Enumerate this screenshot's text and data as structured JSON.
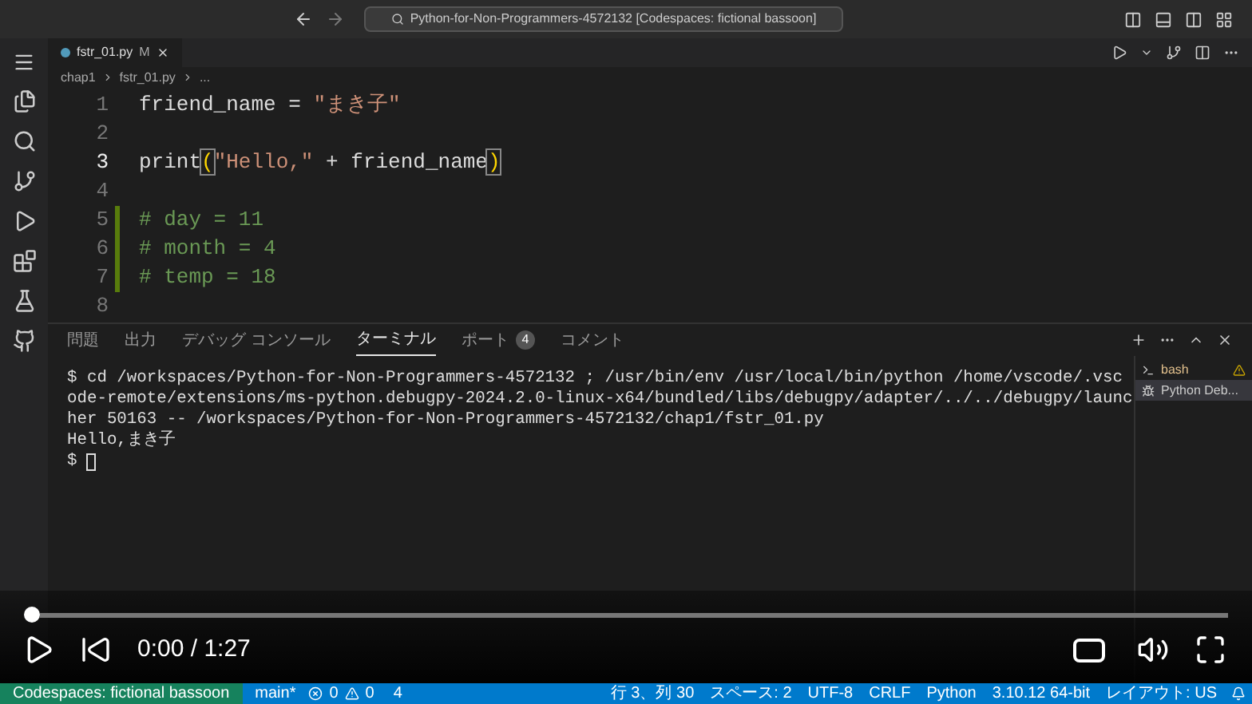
{
  "title_bar": {
    "search": "Python-for-Non-Programmers-4572132 [Codespaces: fictional bassoon]"
  },
  "editor_tabs": [
    {
      "label": "fstr_01.py",
      "badge": "M",
      "selected": true
    }
  ],
  "breadcrumb": [
    "chap1",
    "fstr_01.py",
    "..."
  ],
  "editor": {
    "lines": [
      {
        "number": "1",
        "current": false,
        "tokens": [
          {
            "kind": "plain",
            "text": "friend_name = "
          },
          {
            "kind": "string",
            "text": "\"まき子\""
          }
        ]
      },
      {
        "number": "2",
        "current": false
      },
      {
        "number": "3",
        "current": true,
        "tokens": [
          {
            "kind": "plain",
            "text": "print"
          },
          {
            "kind": "bracket",
            "text": "("
          },
          {
            "kind": "string",
            "text": "\"Hello,\""
          },
          {
            "kind": "plain",
            "text": " + friend_name"
          },
          {
            "kind": "bracket",
            "text": ")"
          }
        ]
      },
      {
        "number": "4",
        "current": false
      },
      {
        "number": "5",
        "current": false,
        "tokens": [
          {
            "kind": "comment",
            "text": "# day = 11"
          }
        ]
      },
      {
        "number": "6",
        "current": false,
        "tokens": [
          {
            "kind": "comment",
            "text": "# month = 4"
          }
        ]
      },
      {
        "number": "7",
        "current": false,
        "tokens": [
          {
            "kind": "comment",
            "text": "# temp = 18"
          }
        ]
      },
      {
        "number": "8",
        "current": false
      }
    ]
  },
  "panel_tabs": [
    {
      "label": "問題",
      "selected": false
    },
    {
      "label": "出力",
      "selected": false
    },
    {
      "label": "デバッグ コンソール",
      "selected": false
    },
    {
      "label": "ターミナル",
      "selected": true
    },
    {
      "label": "ポート",
      "count": "4",
      "selected": false
    },
    {
      "label": "コメント",
      "selected": false
    }
  ],
  "terminal": {
    "lines": [
      "$ cd /workspaces/Python-for-Non-Programmers-4572132 ; /usr/bin/env /usr/local/bin/python /home/vscode/.vsc",
      "ode-remote/extensions/ms-python.debugpy-2024.2.0-linux-x64/bundled/libs/debugpy/adapter/../../debugpy/launc",
      "her 50163 -- /workspaces/Python-for-Non-Programmers-4572132/chap1/fstr_01.py",
      "Hello,まき子",
      "$ "
    ]
  },
  "terminal_list": [
    {
      "label": "bash",
      "kind": "bash",
      "selected": false
    },
    {
      "label": "Python Deb...",
      "kind": "debug",
      "selected": true
    }
  ],
  "video": {
    "level": 0,
    "time": "0:00 / 1:27"
  },
  "status_bar": {
    "remote": "Codespaces: fictional bassoon",
    "branch": "main*",
    "errors": "0",
    "warnings": "0",
    "ports": "4",
    "right": [
      "行 3、列 30",
      "スペース: 2",
      "UTF-8",
      "CRLF",
      "Python",
      "3.10.12 64-bit",
      "レイアウト: US"
    ]
  }
}
